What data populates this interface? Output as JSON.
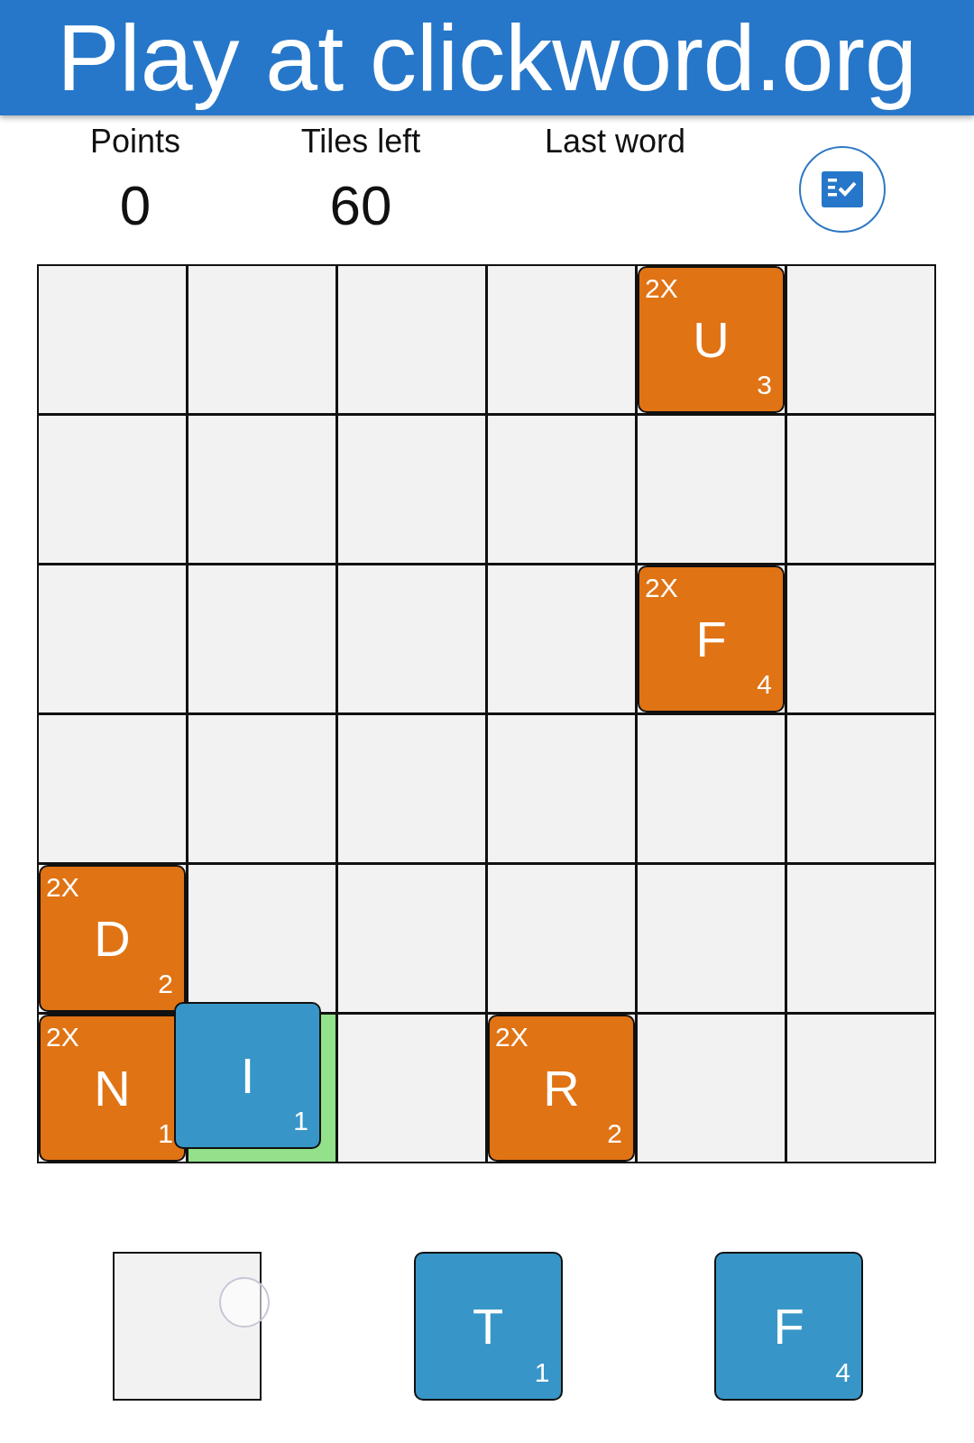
{
  "header": {
    "title": "Play at clickword.org"
  },
  "stats": [
    {
      "label": "Points",
      "value": "0"
    },
    {
      "label": "Tiles left",
      "value": "60"
    },
    {
      "label": "Last word"
    }
  ],
  "board": {
    "rows": [
      [
        {
          "highlighted": false
        },
        {
          "highlighted": false
        },
        {
          "highlighted": false
        },
        {
          "highlighted": false
        },
        {
          "highlighted": false,
          "tile": {
            "bonus": "2X",
            "letter": "U",
            "points": "3"
          }
        },
        {
          "highlighted": false
        }
      ],
      [
        {
          "highlighted": false
        },
        {
          "highlighted": false
        },
        {
          "highlighted": false
        },
        {
          "highlighted": false
        },
        {
          "highlighted": false
        },
        {
          "highlighted": false
        }
      ],
      [
        {
          "highlighted": false
        },
        {
          "highlighted": false
        },
        {
          "highlighted": false
        },
        {
          "highlighted": false
        },
        {
          "highlighted": false,
          "tile": {
            "bonus": "2X",
            "letter": "F",
            "points": "4"
          }
        },
        {
          "highlighted": false
        }
      ],
      [
        {
          "highlighted": false
        },
        {
          "highlighted": false
        },
        {
          "highlighted": false
        },
        {
          "highlighted": false
        },
        {
          "highlighted": false
        },
        {
          "highlighted": false
        }
      ],
      [
        {
          "highlighted": false,
          "tile": {
            "bonus": "2X",
            "letter": "D",
            "points": "2"
          }
        },
        {
          "highlighted": false
        },
        {
          "highlighted": false
        },
        {
          "highlighted": false
        },
        {
          "highlighted": false
        },
        {
          "highlighted": false
        }
      ],
      [
        {
          "highlighted": false,
          "tile": {
            "bonus": "2X",
            "letter": "N",
            "points": "1"
          }
        },
        {
          "highlighted": true
        },
        {
          "highlighted": false
        },
        {
          "highlighted": false,
          "tile": {
            "bonus": "2X",
            "letter": "R",
            "points": "2"
          }
        },
        {
          "highlighted": false
        },
        {
          "highlighted": false
        }
      ]
    ]
  },
  "dragged_tile": {
    "letter": "I",
    "points": "1"
  },
  "tray": [
    {
      "kind": "empty"
    },
    {
      "kind": "tile",
      "letter": "T",
      "points": "1"
    },
    {
      "kind": "tile",
      "letter": "F",
      "points": "4"
    }
  ]
}
